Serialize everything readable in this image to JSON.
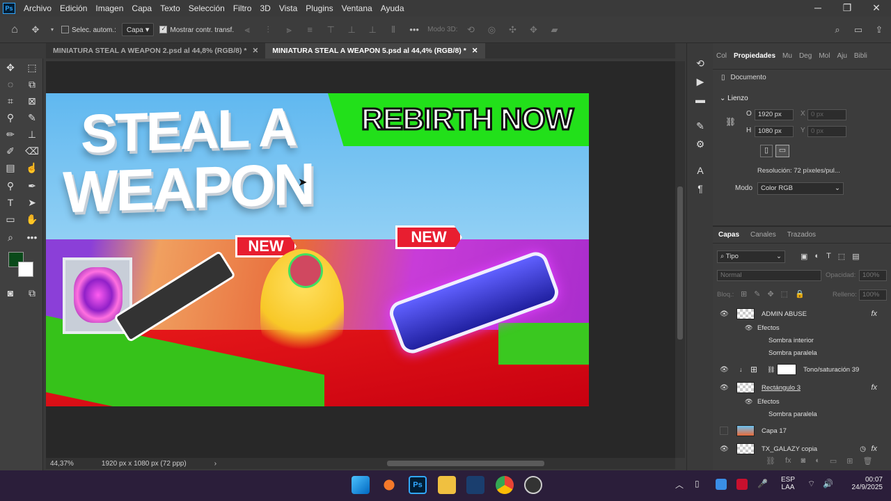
{
  "menubar": {
    "app_icon": "Ps",
    "items": [
      "Archivo",
      "Edición",
      "Imagen",
      "Capa",
      "Texto",
      "Selección",
      "Filtro",
      "3D",
      "Vista",
      "Plugins",
      "Ventana",
      "Ayuda"
    ]
  },
  "window_controls": {
    "minimize": "─",
    "maximize": "❐",
    "close": "✕"
  },
  "options": {
    "auto_select_label": "Selec. autom.:",
    "auto_select_checked": false,
    "target": "Capa",
    "transform_label": "Mostrar contr. transf.",
    "transform_checked": true,
    "mode3d_label": "Modo 3D:"
  },
  "tabs": [
    {
      "label": "MINIATURA STEAL A WEAPON 2.psd al 44,8% (RGB/8) *",
      "active": false
    },
    {
      "label": "MINIATURA STEAL A WEAPON 5.psd al 44,4% (RGB/8) *",
      "active": true
    }
  ],
  "artwork": {
    "title_line1": "STEAL A",
    "title_line2": "WEAPON",
    "banner": "REBIRTH NOW",
    "badge1": "NEW",
    "badge2": "NEW"
  },
  "status": {
    "zoom": "44,37%",
    "dims": "1920 px x 1080 px (72 ppp)"
  },
  "properties": {
    "tabs": [
      "Col",
      "Propiedades",
      "Mu",
      "Deg",
      "Mol",
      "Aju",
      "Bibli"
    ],
    "active_tab": "Propiedades",
    "doc_label": "Documento",
    "section": "Lienzo",
    "w_label": "O",
    "w_value": "1920 px",
    "h_label": "H",
    "h_value": "1080 px",
    "x_label": "X",
    "x_value": "0 px",
    "y_label": "Y",
    "y_value": "0 px",
    "resolution": "Resolución: 72 píxeles/pul...",
    "mode_label": "Modo",
    "mode_value": "Color RGB"
  },
  "layers_panel": {
    "tabs": [
      "Capas",
      "Canales",
      "Trazados"
    ],
    "filter": "Tipo",
    "blend": "Normal",
    "opacity_label": "Opacidad:",
    "opacity": "100%",
    "lock_label": "Bloq.:",
    "fill_label": "Relleno:",
    "fill": "100%",
    "rows": [
      {
        "name": "ADMIN ABUSE",
        "kind": "layer",
        "fx": true
      },
      {
        "name": "Efectos",
        "kind": "effects"
      },
      {
        "name": "Sombra interior",
        "kind": "effect"
      },
      {
        "name": "Sombra paralela",
        "kind": "effect"
      },
      {
        "name": "Tono/saturación 39",
        "kind": "adjust"
      },
      {
        "name": "Rectángulo 3",
        "kind": "layer",
        "fx": true
      },
      {
        "name": "Efectos",
        "kind": "effects"
      },
      {
        "name": "Sombra paralela",
        "kind": "effect"
      },
      {
        "name": "Capa 17",
        "kind": "layer",
        "hidden": true
      },
      {
        "name": "TX_GALAZY copia",
        "kind": "layer",
        "fx": true
      }
    ]
  },
  "taskbar": {
    "lang1": "ESP",
    "lang2": "LAA",
    "time": "00:07",
    "date": "24/9/2025"
  },
  "colors": {
    "fg": "#0a4a1a",
    "bg": "#ffffff",
    "banner_green": "#22e01a",
    "badge_red": "#e81e30"
  }
}
